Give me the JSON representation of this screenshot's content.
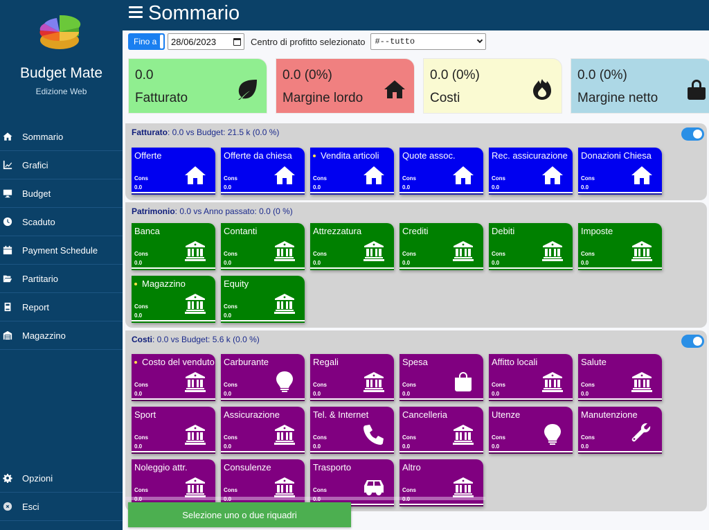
{
  "app": {
    "name": "Budget Mate",
    "edition": "Edizione Web"
  },
  "header": {
    "title": "Sommario"
  },
  "sidebar": {
    "items": [
      {
        "label": "Sommario",
        "icon": "home-icon"
      },
      {
        "label": "Grafici",
        "icon": "chart-line-icon"
      },
      {
        "label": "Budget",
        "icon": "desktop-icon"
      },
      {
        "label": "Scaduto",
        "icon": "clock-icon"
      },
      {
        "label": "Payment Schedule",
        "icon": "calendar-icon"
      },
      {
        "label": "Partitario",
        "icon": "folder-open-icon"
      },
      {
        "label": "Report",
        "icon": "book-icon"
      },
      {
        "label": "Magazzino",
        "icon": "warehouse-icon"
      }
    ],
    "bottom_items": [
      {
        "label": "Opzioni",
        "icon": "gear-icon"
      },
      {
        "label": "Esci",
        "icon": "close-circle-icon"
      }
    ]
  },
  "filters": {
    "until_button": "Fino a",
    "date_value": "28/06/2023",
    "profit_center_label": "Centro di profitto selezionato",
    "profit_center_value": "#--tutto"
  },
  "kpis": [
    {
      "value": "0.0",
      "label": "Fatturato",
      "icon": "leaf-icon",
      "color": "#90ee90"
    },
    {
      "value": "0.0 (0%)",
      "label": "Margine lordo",
      "icon": "home-icon",
      "color": "#f08080"
    },
    {
      "value": "0.0 (0%)",
      "label": "Costi",
      "icon": "fire-icon",
      "color": "#fafad2"
    },
    {
      "value": "0.0 (0%)",
      "label": "Margine netto",
      "icon": "lock-icon",
      "color": "#add8e6"
    }
  ],
  "panels": {
    "fatturato": {
      "title": "Fatturato",
      "summary": ": 0.0 vs Budget: 21.5 k (0.0 %)",
      "toggle_on": true,
      "tiles": [
        {
          "name": "Offerte",
          "cons_label": "Cons",
          "value": "0.0",
          "icon": "home-icon",
          "dot": false
        },
        {
          "name": "Offerte da chiesa",
          "cons_label": "Cons",
          "value": "0.0",
          "icon": "home-icon",
          "dot": false
        },
        {
          "name": "Vendita articoli",
          "cons_label": "Cons",
          "value": "0.0",
          "icon": "home-icon",
          "dot": true
        },
        {
          "name": "Quote assoc.",
          "cons_label": "Cons",
          "value": "0.0",
          "icon": "home-icon",
          "dot": false
        },
        {
          "name": "Rec. assicurazione",
          "cons_label": "Cons",
          "value": "0.0",
          "icon": "home-icon",
          "dot": false
        },
        {
          "name": "Donazioni Chiesa",
          "cons_label": "Cons",
          "value": "0.0",
          "icon": "home-icon",
          "dot": false
        }
      ]
    },
    "patrimonio": {
      "title": "Patrimonio",
      "summary": ": 0.0 vs Anno passato: 0.0 (0 %)",
      "tiles": [
        {
          "name": "Banca",
          "cons_label": "Cons",
          "value": "0.0",
          "icon": "bank-icon",
          "dot": false
        },
        {
          "name": "Contanti",
          "cons_label": "Cons",
          "value": "0.0",
          "icon": "bank-icon",
          "dot": false
        },
        {
          "name": "Attrezzatura",
          "cons_label": "Cons",
          "value": "0.0",
          "icon": "bank-icon",
          "dot": false
        },
        {
          "name": "Crediti",
          "cons_label": "Cons",
          "value": "0.0",
          "icon": "bank-icon",
          "dot": false
        },
        {
          "name": "Debiti",
          "cons_label": "Cons",
          "value": "0.0",
          "icon": "bank-icon",
          "dot": false
        },
        {
          "name": "Imposte",
          "cons_label": "Cons",
          "value": "0.0",
          "icon": "bank-icon",
          "dot": false
        },
        {
          "name": "Magazzino",
          "cons_label": "Cons",
          "value": "0.0",
          "icon": "bank-icon",
          "dot": true
        },
        {
          "name": "Equity",
          "cons_label": "Cons",
          "value": "0.0",
          "icon": "bank-icon",
          "dot": false
        }
      ]
    },
    "costi": {
      "title": "Costi",
      "summary": ": 0.0 vs Budget: 5.6 k (0.0 %)",
      "toggle_on": true,
      "tiles": [
        {
          "name": "Costo del venduto",
          "cons_label": "Cons",
          "value": "0.0",
          "icon": "bank-icon",
          "dot": true
        },
        {
          "name": "Carburante",
          "cons_label": "Cons",
          "value": "0.0",
          "icon": "lightbulb-icon",
          "dot": false
        },
        {
          "name": "Regali",
          "cons_label": "Cons",
          "value": "0.0",
          "icon": "bank-icon",
          "dot": false
        },
        {
          "name": "Spesa",
          "cons_label": "Cons",
          "value": "0.0",
          "icon": "shopping-bag-icon",
          "dot": false
        },
        {
          "name": "Affitto locali",
          "cons_label": "Cons",
          "value": "0.0",
          "icon": "bank-icon",
          "dot": false
        },
        {
          "name": "Salute",
          "cons_label": "Cons",
          "value": "0.0",
          "icon": "bank-icon",
          "dot": false
        },
        {
          "name": "Sport",
          "cons_label": "Cons",
          "value": "0.0",
          "icon": "bank-icon",
          "dot": false
        },
        {
          "name": "Assicurazione",
          "cons_label": "Cons",
          "value": "0.0",
          "icon": "bank-icon",
          "dot": false
        },
        {
          "name": "Tel. & Internet",
          "cons_label": "Cons",
          "value": "0.0",
          "icon": "phone-icon",
          "dot": false
        },
        {
          "name": "Cancelleria",
          "cons_label": "Cons",
          "value": "0.0",
          "icon": "bank-icon",
          "dot": false
        },
        {
          "name": "Utenze",
          "cons_label": "Cons",
          "value": "0.0",
          "icon": "lightbulb-icon",
          "dot": false
        },
        {
          "name": "Manutenzione",
          "cons_label": "Cons",
          "value": "0.0",
          "icon": "wrench-icon",
          "dot": false
        },
        {
          "name": "Noleggio attr.",
          "cons_label": "Cons",
          "value": "0.0",
          "icon": "bank-icon",
          "dot": false
        },
        {
          "name": "Consulenze",
          "cons_label": "Cons",
          "value": "0.0",
          "icon": "bank-icon",
          "dot": false
        },
        {
          "name": "Trasporto",
          "cons_label": "Cons",
          "value": "0.0",
          "icon": "car-icon",
          "dot": false
        },
        {
          "name": "Altro",
          "cons_label": "Cons",
          "value": "0.0",
          "icon": "bank-icon",
          "dot": false
        }
      ]
    }
  },
  "toast": {
    "message": "Selezione uno o due riquadri"
  }
}
